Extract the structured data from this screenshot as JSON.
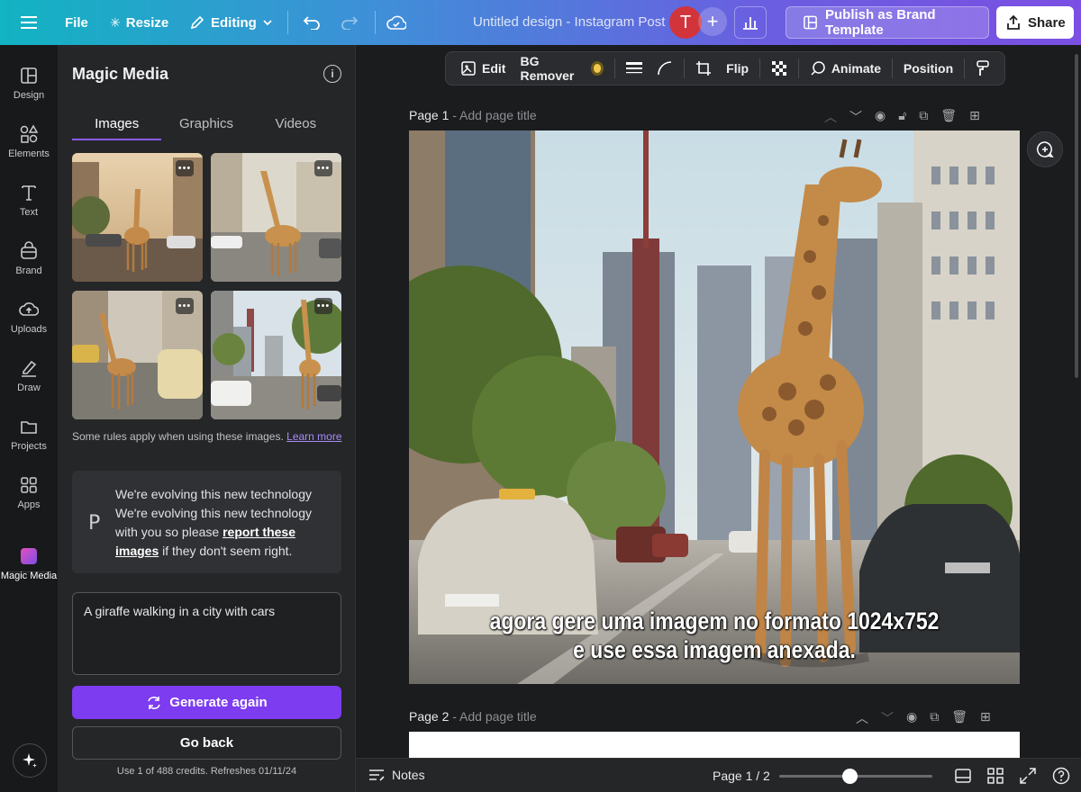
{
  "topbar": {
    "file": "File",
    "resize": "Resize",
    "editing": "Editing",
    "doc_title": "Untitled design - Instagram Post",
    "avatar_letter": "T",
    "plus": "+",
    "publish": "Publish as Brand Template",
    "share": "Share"
  },
  "rail": [
    {
      "label": "Design",
      "icon": "layout-icon"
    },
    {
      "label": "Elements",
      "icon": "shapes-icon"
    },
    {
      "label": "Text",
      "icon": "text-icon"
    },
    {
      "label": "Brand",
      "icon": "brand-icon"
    },
    {
      "label": "Uploads",
      "icon": "cloud-upload-icon"
    },
    {
      "label": "Draw",
      "icon": "pen-icon"
    },
    {
      "label": "Projects",
      "icon": "folder-icon"
    },
    {
      "label": "Apps",
      "icon": "apps-icon"
    },
    {
      "label": "Magic Media",
      "icon": "magic-media-icon"
    }
  ],
  "panel": {
    "title": "Magic Media",
    "tabs": [
      "Images",
      "Graphics",
      "Videos"
    ],
    "rules_text": "Some rules apply when using these images.",
    "rules_link": "Learn more",
    "notice": {
      "icon_letter": "P",
      "line1": "We're evolving this new technology",
      "line2": "We're evolving this new technology with you so please",
      "link": "report these images",
      "line3": "if they don't seem right."
    },
    "prompt_value": "A giraffe walking in a city with cars",
    "generate": "Generate again",
    "go_back": "Go back",
    "credits": "Use 1 of 488 credits. Refreshes 01/11/24",
    "more": "•••"
  },
  "context_toolbar": {
    "edit": "Edit",
    "bg_remover": "BG Remover",
    "flip": "Flip",
    "animate": "Animate",
    "position": "Position"
  },
  "pages": [
    {
      "label": "Page 1",
      "sub": " - Add page title"
    },
    {
      "label": "Page 2",
      "sub": " - Add page title"
    }
  ],
  "caption": {
    "line1": "agora gere uma imagem no formato 1024x752",
    "line2": "e use essa imagem anexada."
  },
  "bottombar": {
    "notes": "Notes",
    "page_indicator": "Page 1 / 2",
    "zoom_fraction": 0.46
  },
  "colors": {
    "accent": "#7d3cf0",
    "avatar": "#d2343c",
    "topbar_start": "#12b3c2",
    "topbar_end": "#7b4fe3"
  }
}
